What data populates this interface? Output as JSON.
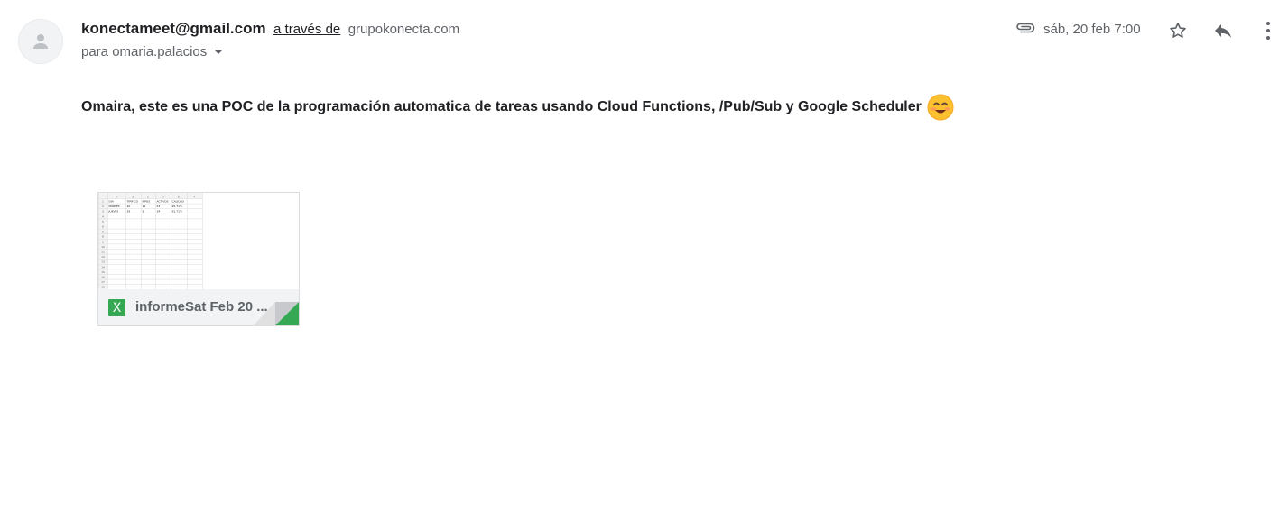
{
  "sender": {
    "email": "konectameet@gmail.com",
    "via_label": "a través de",
    "via_domain": "grupokonecta.com"
  },
  "recipient": {
    "label": "para omaria.palacios"
  },
  "header": {
    "date": "sáb, 20 feb 7:00"
  },
  "message": {
    "body": "Omaira, este es una POC de la programación automatica de tareas usando Cloud Functions, /Pub/Sub y Google Scheduler"
  },
  "attachment": {
    "name": "informeSat Feb 20 ...",
    "file_type_icon": "X",
    "thumbnail": {
      "col_letters": [
        "A",
        "B",
        "C",
        "D",
        "E",
        "F"
      ],
      "rows": [
        [
          "DIA",
          "TIPIFICO",
          "MPOS",
          "ACTIVOS",
          "CALIDAD"
        ],
        [
          "MARTES",
          "40",
          "12",
          "53",
          "95.71%"
        ],
        [
          "JUEVES",
          "29",
          "5",
          "34",
          "91.71%"
        ]
      ]
    }
  },
  "icons": {
    "avatar": "person-icon",
    "attachment_indicator": "paperclip-icon",
    "star": "star-outline-icon",
    "reply": "reply-icon",
    "more": "more-vert-icon",
    "emoji": "smiling-face-icon"
  },
  "colors": {
    "excel_green": "#34a853",
    "text_primary": "#202124",
    "text_secondary": "#5f6368"
  }
}
